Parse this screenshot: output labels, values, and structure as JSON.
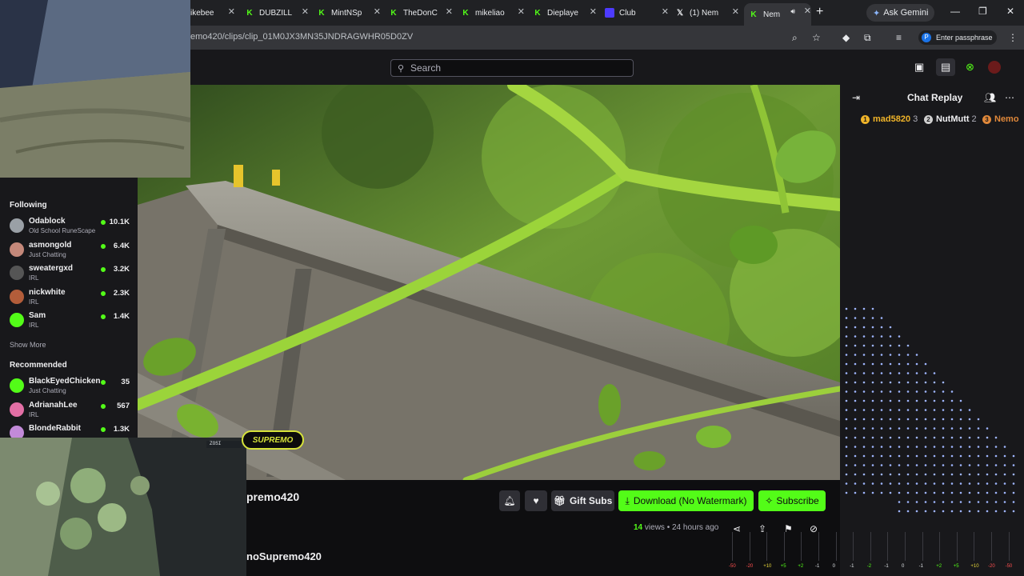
{
  "browser": {
    "tabs": [
      {
        "title": "ikebee",
        "favicon": "kick",
        "active": false
      },
      {
        "title": "DUBZILL",
        "favicon": "kick",
        "active": false
      },
      {
        "title": "MintNSp",
        "favicon": "kick",
        "active": false
      },
      {
        "title": "TheDonC",
        "favicon": "kick",
        "active": false
      },
      {
        "title": "mikeliao",
        "favicon": "kick",
        "active": false
      },
      {
        "title": "Dieplaye",
        "favicon": "kick",
        "active": false
      },
      {
        "title": "Club",
        "favicon": "club",
        "active": false
      },
      {
        "title": "(1) Nem",
        "favicon": "x",
        "active": false
      },
      {
        "title": "Nem",
        "favicon": "kick",
        "active": true
      }
    ],
    "ask_gemini": "Ask Gemini",
    "url": "emo420/clips/clip_01M0JX3MN35JNDRAGWHR05D0ZV",
    "passphrase": "Enter passphrase",
    "passphrase_badge": "P"
  },
  "header": {
    "search_placeholder": "Search"
  },
  "sidebar": {
    "following_title": "Following",
    "following": [
      {
        "name": "Odablock",
        "category": "Old School RuneScape",
        "viewers": "10.1K",
        "color": "#9aa0a6"
      },
      {
        "name": "asmongold",
        "category": "Just Chatting",
        "viewers": "6.4K",
        "color": "#c4887a"
      },
      {
        "name": "sweatergxd",
        "category": "IRL",
        "viewers": "3.2K",
        "color": "#555"
      },
      {
        "name": "nickwhite",
        "category": "IRL",
        "viewers": "2.3K",
        "color": "#b35d3a"
      },
      {
        "name": "Sam",
        "category": "IRL",
        "viewers": "1.4K",
        "color": "#53fc18"
      }
    ],
    "show_more": "Show More",
    "recommended_title": "Recommended",
    "recommended": [
      {
        "name": "BlackEyedChicken",
        "category": "Just Chatting",
        "viewers": "35",
        "color": "#53fc18"
      },
      {
        "name": "AdrianahLee",
        "category": "IRL",
        "viewers": "567",
        "color": "#e36fa5"
      },
      {
        "name": "BlondeRabbit",
        "category": "",
        "viewers": "1.3K",
        "color": "#c28ad8"
      }
    ]
  },
  "clip": {
    "channel_title": "premo420",
    "channel_name": "noSupremo420",
    "overlay_logo": "SUPREMO",
    "cam_label": "ZOSI",
    "views_count": "14",
    "views_label": "views",
    "time_ago": "24 hours ago",
    "gift_subs": "Gift Subs",
    "download": "Download (No Watermark)",
    "subscribe": "Subscribe"
  },
  "chat": {
    "title": "Chat Replay",
    "gifters": [
      {
        "name": "mad5820",
        "count": "3",
        "rank": "1",
        "color": "#f0b429"
      },
      {
        "name": "NutMutt",
        "count": "2",
        "rank": "2",
        "color": "#d0d0d0"
      },
      {
        "name": "Nemo",
        "count": "",
        "rank": "3",
        "color": "#e0883a"
      }
    ]
  },
  "meter": {
    "labels": [
      "-50",
      "-20",
      "+10",
      "+5",
      "+2",
      "-1",
      "0",
      "-1",
      "-2",
      "-1",
      "0",
      "-1",
      "+2",
      "+5",
      "+10",
      "-20",
      "-50"
    ]
  },
  "colors": {
    "accent": "#53fc18",
    "background": "#0e0e10",
    "panel": "#18181b"
  }
}
